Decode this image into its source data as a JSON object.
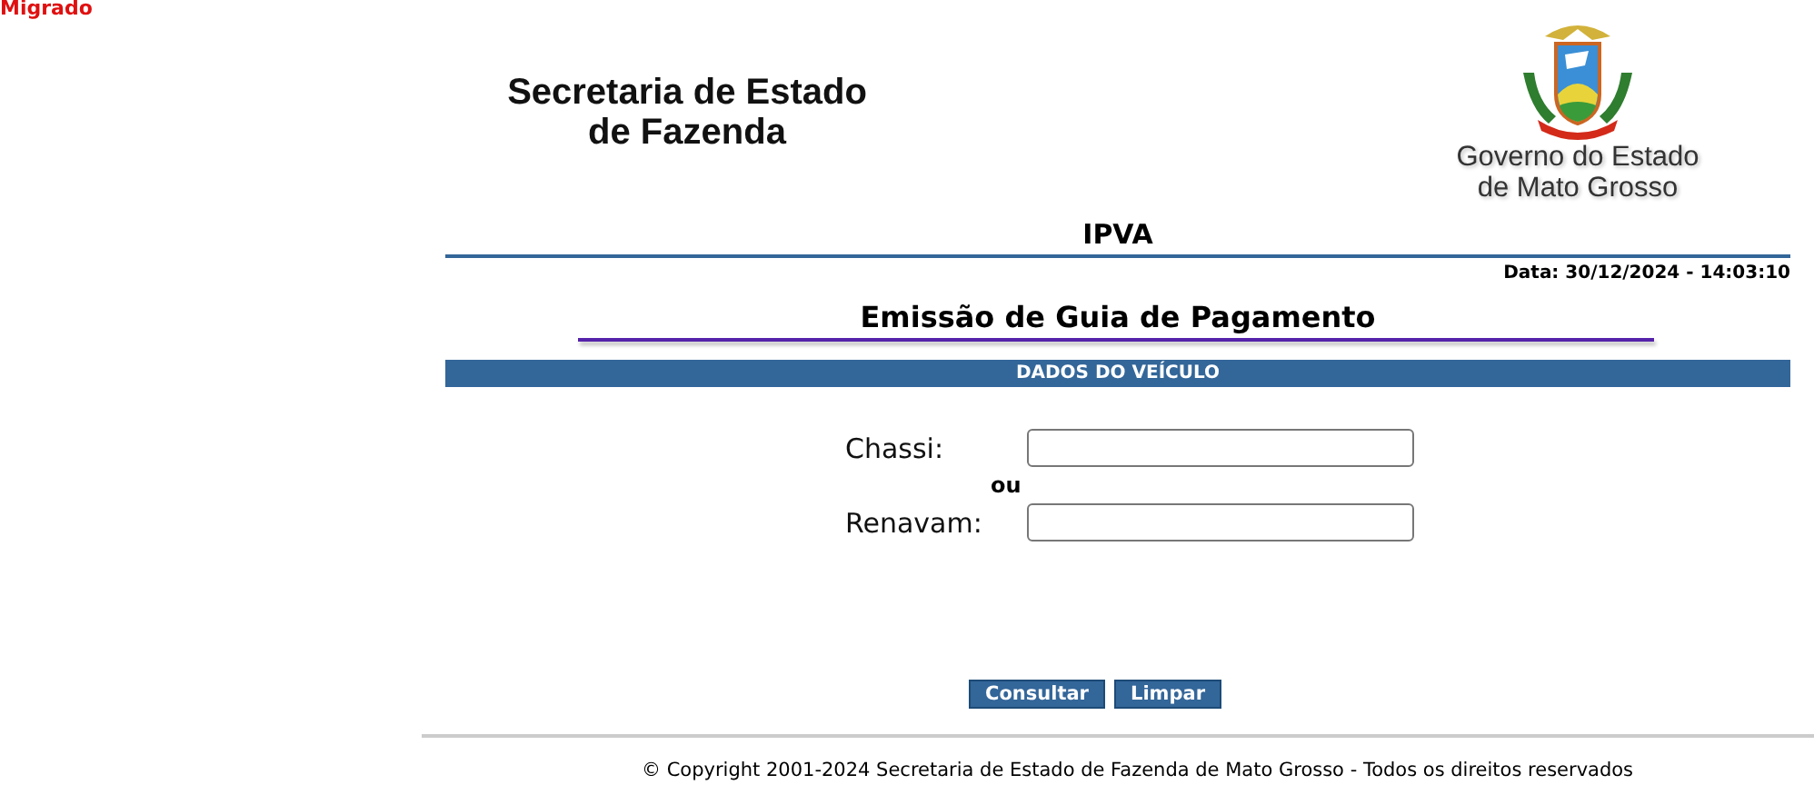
{
  "badge": "Migrado",
  "header": {
    "agency": [
      "Secretaria de Estado",
      "de Fazenda"
    ],
    "government": [
      "Governo do Estado",
      "de Mato Grosso"
    ]
  },
  "system": "IPVA",
  "date": "Data: 30/12/2024 - 14:03:10",
  "title": "Emissão de Guia de Pagamento",
  "section": "DADOS DO VEÍCULO",
  "fields": [
    {
      "label": "Chassi:"
    },
    {
      "label": "Renavam:"
    }
  ],
  "separator": "ou",
  "buttons": [
    "Consultar",
    "Limpar"
  ],
  "footer": "© Copyright 2001-2024 Secretaria de Estado de Fazenda de Mato Grosso - Todos os direitos reservados"
}
